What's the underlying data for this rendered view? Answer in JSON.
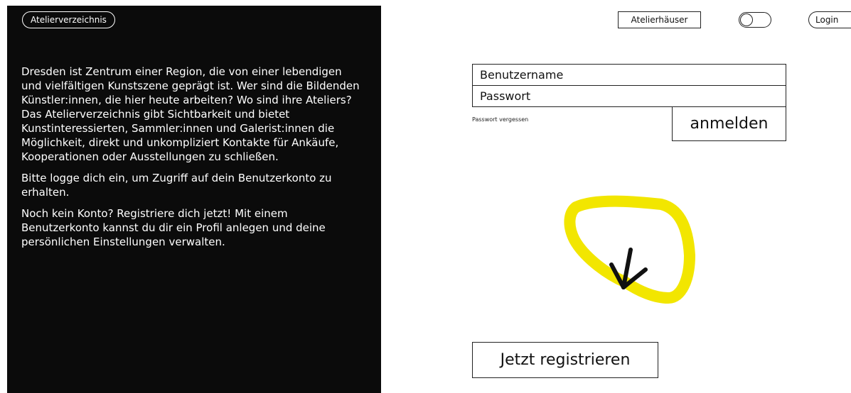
{
  "site": {
    "name": "Atelierverzeichnis"
  },
  "intro": {
    "paragraphs": [
      "Dresden ist Zentrum einer Region, die von einer lebendigen und vielfältigen Kunstszene geprägt ist. Wer sind die Bildenden Künstler:innen, die hier heute arbeiten? Wo sind ihre Ateliers? Das Atelierverzeichnis gibt Sichtbarkeit und bietet Kunstinteressierten, Sammler:innen und Galerist:innen die Möglichkeit, direkt und unkompliziert Kontakte für Ankäufe, Kooperationen oder Ausstellungen zu schließen.",
      "Bitte logge dich ein, um Zugriff auf dein Benutzerkonto zu erhalten.",
      "Noch kein Konto? Registriere dich jetzt! Mit einem Benutzerkonto kannst du dir ein Profil anlegen und deine persönlichen Einstellungen verwalten."
    ]
  },
  "nav": {
    "atelierhaeuser": "Atelierhäuser",
    "toggle_state": "off",
    "login": "Login"
  },
  "login": {
    "username_placeholder": "Benutzername",
    "username_value": "",
    "password_placeholder": "Passwort",
    "password_value": "",
    "forgot_label": "Passwort vergessen",
    "submit_label": "anmelden"
  },
  "annotation": {
    "icon": "arrow-down-left-icon",
    "highlight_color": "#f2e600",
    "arrow_color": "#111111"
  },
  "register": {
    "label": "Jetzt registrieren"
  },
  "colors": {
    "panel": "#0b0b0b",
    "panel_text": "#ffffff",
    "border": "#222222"
  }
}
